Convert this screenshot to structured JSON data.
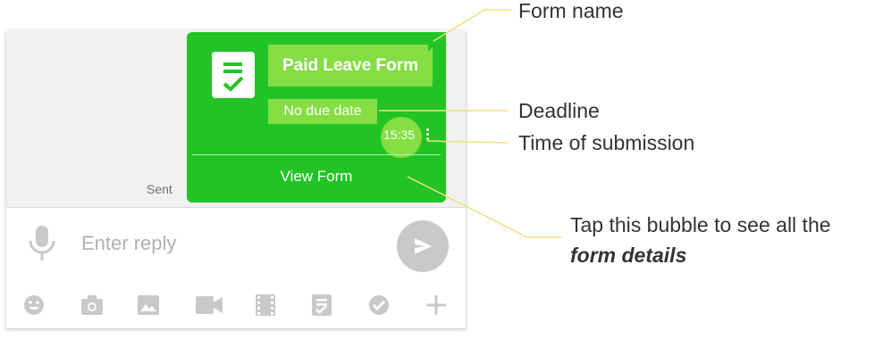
{
  "chat": {
    "sent_label": "Sent",
    "bubble": {
      "form_name": "Paid Leave Form",
      "deadline": "No due date",
      "time": "15:35",
      "view_form": "View Form"
    },
    "composer": {
      "placeholder": "Enter reply"
    },
    "toolbar": [
      "smiley-icon",
      "camera-icon",
      "image-icon",
      "video-camera-icon",
      "film-icon",
      "form-icon",
      "check-circle-icon",
      "plus-icon"
    ]
  },
  "annotations": {
    "form_name": "Form name",
    "deadline": "Deadline",
    "time_of_submission": "Time of submission",
    "tap_line1": "Tap this bubble to see all the",
    "tap_line2": "form details"
  },
  "colors": {
    "bubble_green": "#22c425",
    "highlight_green": "#84dd43",
    "leader_yellow": "#f2de7a",
    "icon_gray": "#c9c9c9"
  }
}
